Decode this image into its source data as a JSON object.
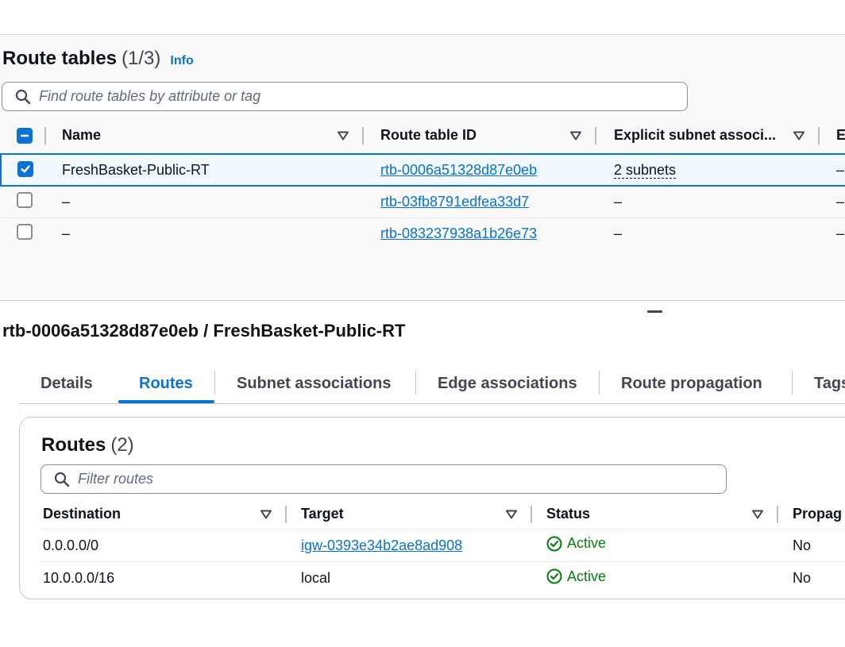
{
  "route_tables": {
    "title": "Route tables",
    "count": "(1/3)",
    "info_label": "Info",
    "search_placeholder": "Find route tables by attribute or tag",
    "columns": [
      "Name",
      "Route table ID",
      "Explicit subnet associ...",
      "Ed"
    ],
    "rows": [
      {
        "selected": true,
        "name": "FreshBasket-Public-RT",
        "id": "rtb-0006a51328d87e0eb",
        "subnets": "2 subnets",
        "edge": "–"
      },
      {
        "selected": false,
        "name": "–",
        "id": "rtb-03fb8791edfea33d7",
        "subnets": "–",
        "edge": "–"
      },
      {
        "selected": false,
        "name": "–",
        "id": "rtb-083237938a1b26e73",
        "subnets": "–",
        "edge": "–"
      }
    ]
  },
  "details": {
    "title": "rtb-0006a51328d87e0eb / FreshBasket-Public-RT",
    "tabs": [
      "Details",
      "Routes",
      "Subnet associations",
      "Edge associations",
      "Route propagation",
      "Tags"
    ],
    "active_tab": "Routes"
  },
  "routes": {
    "title": "Routes",
    "count": "(2)",
    "search_placeholder": "Filter routes",
    "columns": [
      "Destination",
      "Target",
      "Status",
      "Propag"
    ],
    "rows": [
      {
        "destination": "0.0.0.0/0",
        "target": "igw-0393e34b2ae8ad908",
        "target_is_link": true,
        "status": "Active",
        "propagated": "No"
      },
      {
        "destination": "10.0.0.0/16",
        "target": "local",
        "target_is_link": false,
        "status": "Active",
        "propagated": "No"
      }
    ]
  },
  "colors": {
    "link": "#0972d3",
    "status_active": "#037f0c",
    "selected_bg": "#f1f8ff"
  },
  "icons": [
    "search-icon",
    "sort-caret-icon",
    "checkbox-indeterminate-icon",
    "checkbox-checked-icon",
    "status-success-icon",
    "resize-handle-icon"
  ]
}
